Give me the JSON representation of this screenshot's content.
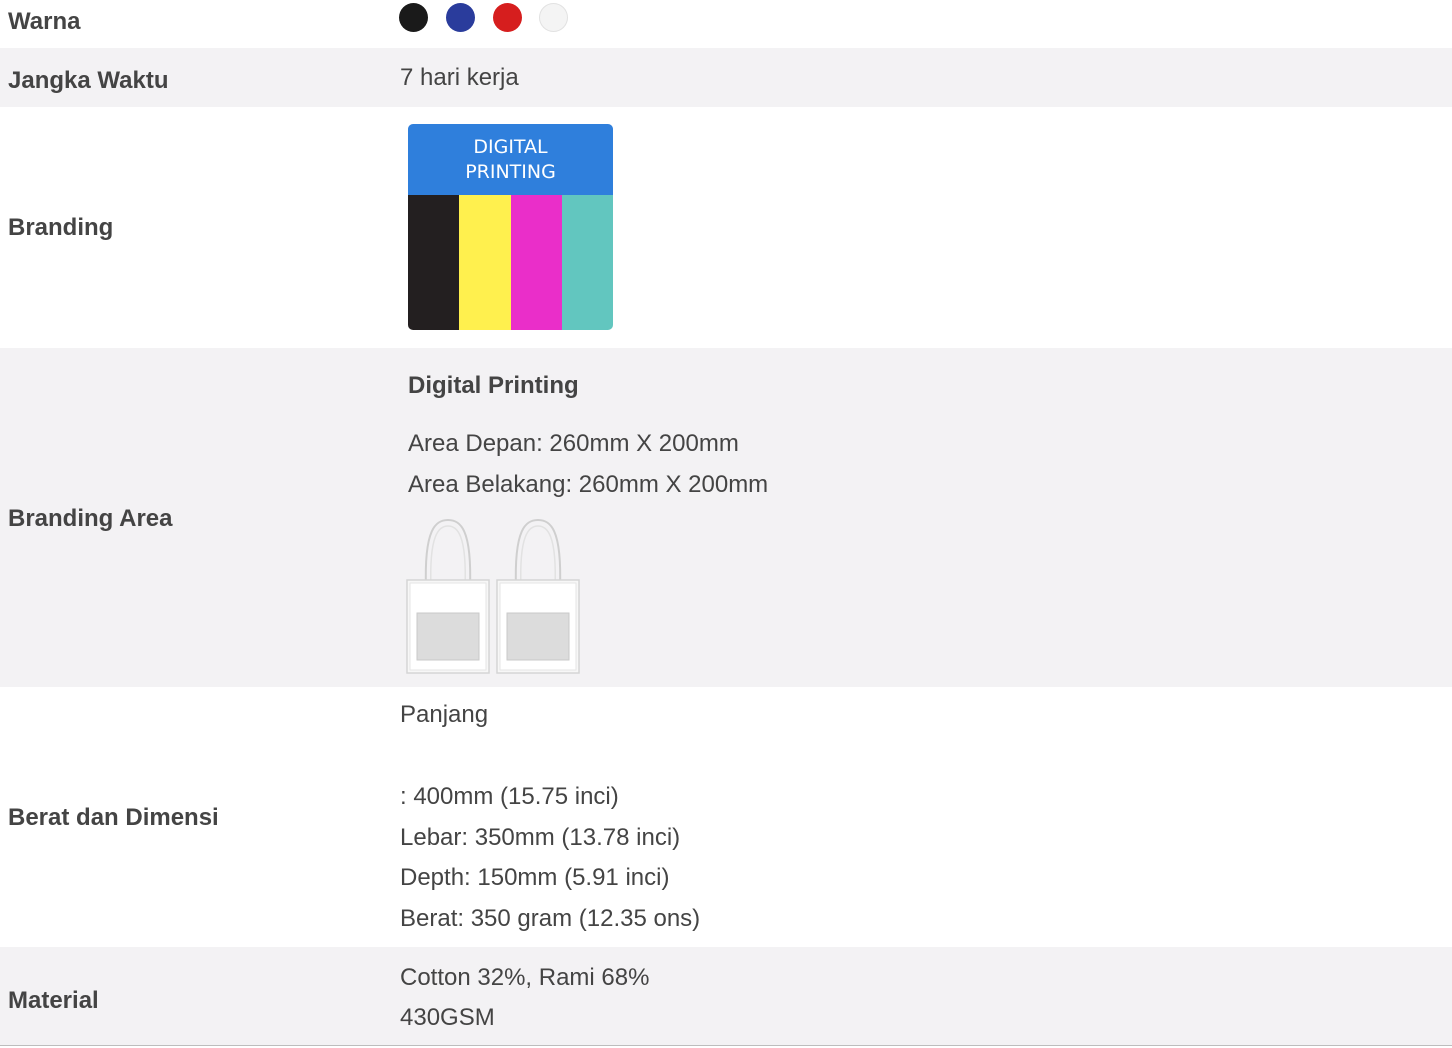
{
  "colors": {
    "label": "Warna",
    "swatches": [
      "#1a1a1a",
      "#2a3c9c",
      "#d61e1e",
      "#f4f4f4"
    ]
  },
  "lead_time": {
    "label": "Jangka Waktu",
    "value": "7 hari kerja"
  },
  "branding": {
    "label": "Branding",
    "badge_title_line1": "DIGITAL",
    "badge_title_line2": "PRINTING",
    "badge_colors": [
      "#231f20",
      "#fff04e",
      "#ea2ec9",
      "#62c6bf"
    ]
  },
  "branding_area": {
    "label": "Branding Area",
    "method": "Digital Printing",
    "front": "Area Depan: 260mm X 200mm",
    "back": "Area Belakang: 260mm X 200mm"
  },
  "dimensions": {
    "label": "Berat dan Dimensi",
    "lines": [
      "Panjang",
      ": 400mm (15.75 inci)",
      "Lebar: 350mm (13.78 inci)",
      "Depth: 150mm (5.91 inci)",
      "Berat: 350 gram (12.35 ons)"
    ]
  },
  "material": {
    "label": "Material",
    "lines": [
      "Cotton 32%, Rami 68%",
      "430GSM"
    ]
  }
}
